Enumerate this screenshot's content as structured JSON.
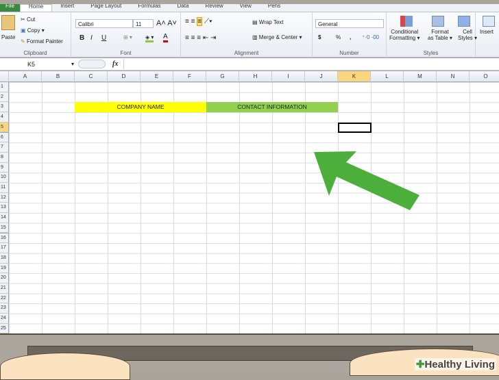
{
  "ribbon_tabs": [
    "File",
    "Home",
    "Insert",
    "Page Layout",
    "Formulas",
    "Data",
    "Review",
    "View",
    "Pens"
  ],
  "clipboard": {
    "paste": "Paste",
    "cut": "Cut",
    "copy": "Copy",
    "format_painter": "Format Painter",
    "label": "Clipboard"
  },
  "font": {
    "name": "Calibri",
    "size": "11",
    "bold": "B",
    "italic": "I",
    "underline": "U",
    "font_color": "A",
    "label": "Font"
  },
  "alignment": {
    "wrap_text": "Wrap Text",
    "merge_center": "Merge & Center",
    "label": "Alignment"
  },
  "number": {
    "format": "General",
    "currency": "$",
    "percent": "%",
    "comma": ",",
    "label": "Number"
  },
  "styles": {
    "conditional": "Conditional",
    "conditional2": "Formatting",
    "format_table": "Format",
    "format_table2": "as Table",
    "cell_styles": "Cell",
    "cell_styles2": "Styles",
    "label": "Styles"
  },
  "cells_group": {
    "insert": "Insert"
  },
  "formula_bar": {
    "name_box": "K5",
    "fx": "fx",
    "value": ""
  },
  "columns": [
    "A",
    "B",
    "C",
    "D",
    "E",
    "F",
    "G",
    "H",
    "I",
    "J",
    "K",
    "L",
    "M",
    "N",
    "O"
  ],
  "rows": [
    "1",
    "2",
    "3",
    "4",
    "5",
    "6",
    "7",
    "8",
    "9",
    "10",
    "11",
    "12",
    "13",
    "14",
    "15",
    "16",
    "17",
    "18",
    "19",
    "20",
    "21",
    "22",
    "23",
    "24",
    "25"
  ],
  "cells": {
    "company_name": "COMPANY NAME",
    "contact_info": "CONTACT INFORMATION"
  },
  "colors": {
    "company_fill": "#ffff00",
    "contact_fill": "#92d050",
    "arrow": "#4caf3c"
  },
  "watermark": "Healthy Living"
}
